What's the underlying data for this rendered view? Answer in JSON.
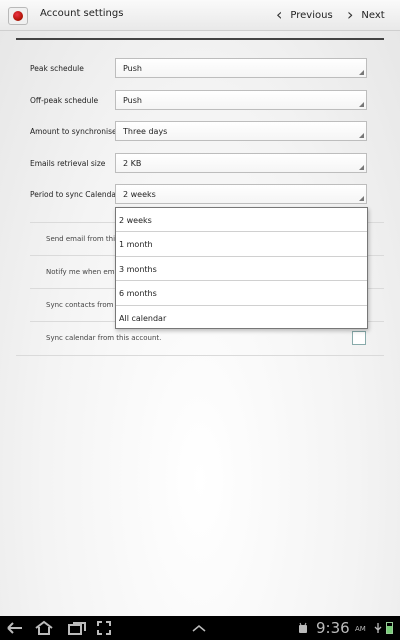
{
  "header": {
    "title": "Account settings",
    "prev_label": "Previous",
    "next_label": "Next"
  },
  "settings": [
    {
      "label": "Peak schedule",
      "value": "Push"
    },
    {
      "label": "Off-peak schedule",
      "value": "Push"
    },
    {
      "label": "Amount to synchronise",
      "value": "Three days"
    },
    {
      "label": "Emails retrieval size",
      "value": "2 KB"
    },
    {
      "label": "Period to sync Calendar",
      "value": "2 weeks"
    }
  ],
  "checkboxes": [
    {
      "label": "Send email from this"
    },
    {
      "label": "Notify me when ema"
    },
    {
      "label": "Sync contacts from th"
    },
    {
      "label": "Sync calendar from this account."
    }
  ],
  "dropdown": {
    "options": [
      "2 weeks",
      "1 month",
      "3 months",
      "6 months",
      "All calendar"
    ]
  },
  "statusbar": {
    "time": "9:36",
    "ampm": "AM"
  }
}
